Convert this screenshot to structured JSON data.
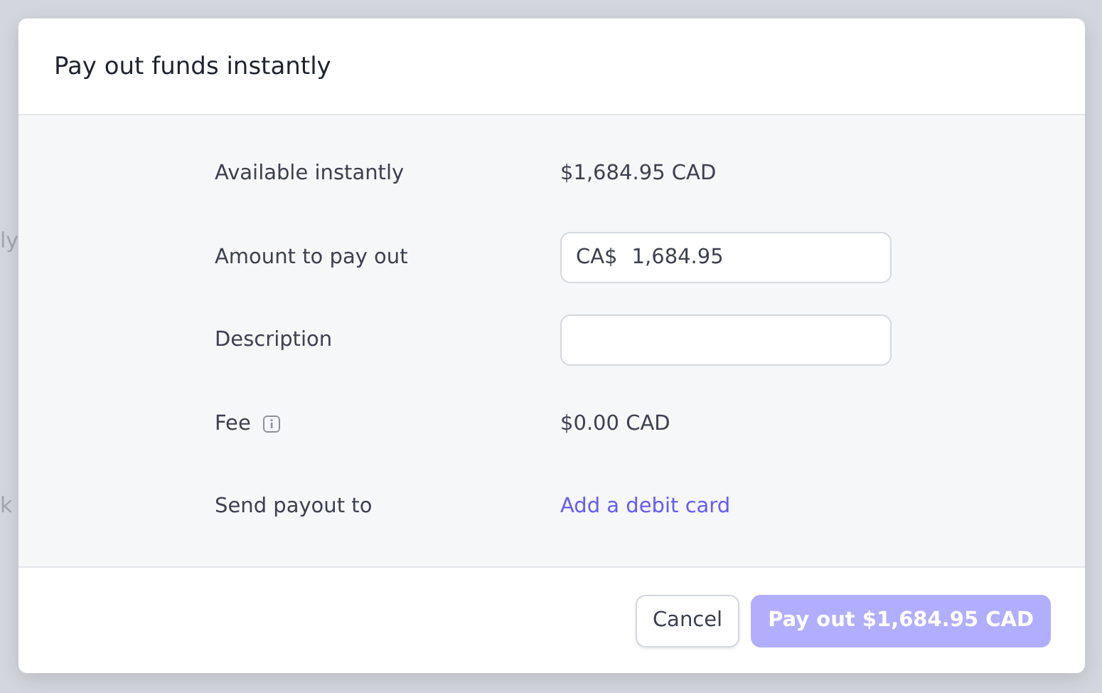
{
  "background_fragments": [
    {
      "text": "ly"
    },
    {
      "text": "k"
    }
  ],
  "dialog": {
    "title": "Pay out funds instantly",
    "rows": [
      {
        "label": "Available instantly",
        "kind": "text",
        "value": "$1,684.95 CAD"
      },
      {
        "label": "Amount to pay out",
        "kind": "input",
        "prefix": "CA$",
        "value": "1,684.95"
      },
      {
        "label": "Description",
        "kind": "input"
      },
      {
        "label": "Fee",
        "kind": "text",
        "info": true,
        "value": "$0.00 CAD"
      },
      {
        "label": "Send payout to",
        "kind": "link",
        "value": "Add a debit card"
      }
    ],
    "buttons": [
      {
        "label": "Cancel",
        "kind": "secondary",
        "disabled": false
      },
      {
        "label": "Pay out $1,684.95 CAD",
        "kind": "primary",
        "disabled": true
      }
    ]
  }
}
